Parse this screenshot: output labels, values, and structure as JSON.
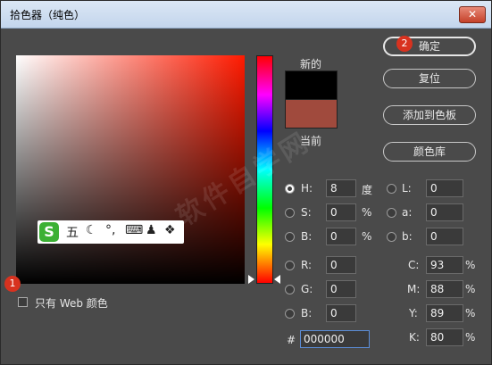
{
  "window": {
    "title": "拾色器（纯色）",
    "close_icon": "close-icon"
  },
  "buttons": {
    "ok": "确定",
    "reset": "复位",
    "add_to_swatches": "添加到色板",
    "color_libraries": "颜色库"
  },
  "badges": {
    "one": "1",
    "two": "2"
  },
  "swatches": {
    "new_label": "新的",
    "current_label": "当前",
    "new_color": "#000000",
    "current_color": "#a04a3d"
  },
  "web_only": {
    "label": "只有 Web 颜色",
    "checked": false
  },
  "ime_toolbar": {
    "logo": "S",
    "mode": "五",
    "items": [
      "moon-icon",
      "punctuation-icon",
      "keyboard-icon",
      "user-icon",
      "grid-icon"
    ]
  },
  "hsb": {
    "h": {
      "label": "H:",
      "value": "8",
      "unit": "度",
      "selected": true
    },
    "s": {
      "label": "S:",
      "value": "0",
      "unit": "%"
    },
    "b": {
      "label": "B:",
      "value": "0",
      "unit": "%"
    }
  },
  "lab": {
    "l": {
      "label": "L:",
      "value": "0"
    },
    "a": {
      "label": "a:",
      "value": "0"
    },
    "b": {
      "label": "b:",
      "value": "0"
    }
  },
  "rgb": {
    "r": {
      "label": "R:",
      "value": "0"
    },
    "g": {
      "label": "G:",
      "value": "0"
    },
    "b": {
      "label": "B:",
      "value": "0"
    }
  },
  "cmyk": {
    "c": {
      "label": "C:",
      "value": "93",
      "unit": "%"
    },
    "m": {
      "label": "M:",
      "value": "88",
      "unit": "%"
    },
    "y": {
      "label": "Y:",
      "value": "89",
      "unit": "%"
    },
    "k": {
      "label": "K:",
      "value": "80",
      "unit": "%"
    }
  },
  "hex": {
    "label": "#",
    "value": "000000"
  },
  "colors": {
    "accent": "#d8321f",
    "window_bg": "#4a4a4a",
    "ime_green": "#3cb034"
  }
}
